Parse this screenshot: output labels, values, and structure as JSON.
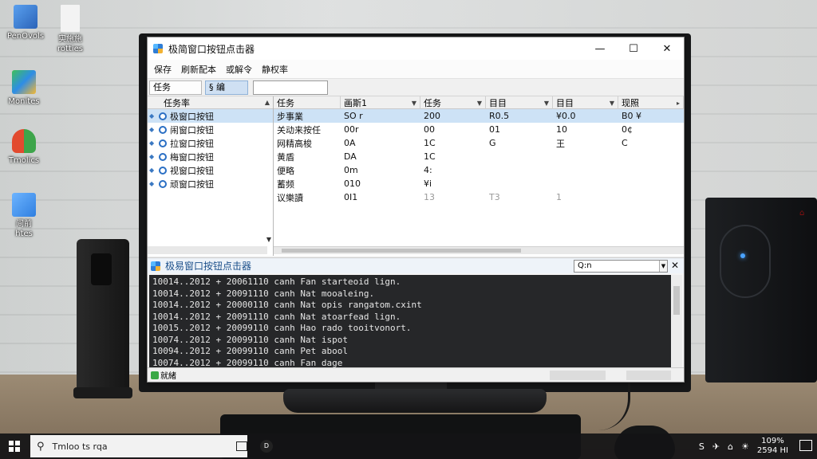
{
  "desktop": {
    "icons": [
      {
        "label": "PenOvols",
        "color": "#3b7fd6"
      },
      {
        "label": "实施施\nrotties",
        "color": "#eeeeee"
      },
      {
        "label": "Monites",
        "color": "#e7442f"
      },
      {
        "label": "Tmolics",
        "color": "#3fa94a"
      },
      {
        "label": "间前\nhtes",
        "color": "#3b90e0"
      }
    ]
  },
  "window": {
    "title": "极简窗口按钮点击器",
    "controls": {
      "minimize": "—",
      "maximize": "☐",
      "close": "✕"
    },
    "menu": [
      "保存",
      "刷新配本",
      "或解令",
      "静权率"
    ],
    "toolbar": {
      "tab1": "任务",
      "tab2": "§ 编",
      "input_value": ""
    },
    "left_pane": {
      "header": "任务率",
      "items": [
        {
          "label": "极窗口按钮",
          "selected": true
        },
        {
          "label": "闹窗口按钮",
          "selected": false
        },
        {
          "label": "拉窗口按钮",
          "selected": false
        },
        {
          "label": "梅窗口按钮",
          "selected": false
        },
        {
          "label": "视窗口按钮",
          "selected": false
        },
        {
          "label": "顽窗口按钮",
          "selected": false
        }
      ]
    },
    "grid": {
      "columns": [
        "任务",
        "画斯1",
        "任务",
        "目目",
        "目目",
        "现照"
      ],
      "rows": [
        [
          "步事業",
          "SO r",
          "200",
          "R0.5",
          "¥0.0",
          "B0 ¥"
        ],
        [
          "关动来按任",
          "00r",
          "00",
          "01",
          "10",
          "0¢"
        ],
        [
          "网精高梭",
          "0A",
          "1C",
          "G",
          "王",
          "C"
        ],
        [
          "黄盾",
          "DA",
          "1C",
          "",
          "",
          ""
        ],
        [
          "便略",
          "0m",
          "4:",
          "",
          "",
          ""
        ],
        [
          "蓄频",
          "010",
          "¥i",
          "",
          "",
          ""
        ],
        [
          "议樂讀",
          "0I1",
          "13",
          "T3",
          "1",
          ""
        ]
      ]
    },
    "log_panel": {
      "title": "极易窗口按钮点击器",
      "search_value": "Q:n",
      "close": "✕",
      "lines": [
        "10014..2012 + 20061110 canh Fan starteoid lign.",
        "10014..2012 + 20091110 canh Nat mooaleing.",
        "10014..2012 + 20000110 canh Nat opis rangatom.cxint",
        "10014..2012 + 20091110 canh Nat atoarfead lign.",
        "10015..2012 + 20099110 canh Hao rado tooitvonort.",
        "10074..2012 + 20099110 canh Nat ispot",
        "10094..2012 + 20099110 canh Pet abool",
        "10074..2012 + 20099110 canh Fan dage"
      ]
    },
    "status": {
      "text": "就緒"
    }
  },
  "taskbar": {
    "search_text": "Tmloo ts rqa",
    "search_icon": "search-icon",
    "tray_icons": [
      "S",
      "✈",
      "⌂",
      "☀"
    ],
    "clock_line1": "109%",
    "clock_line2": "2594 HI"
  }
}
